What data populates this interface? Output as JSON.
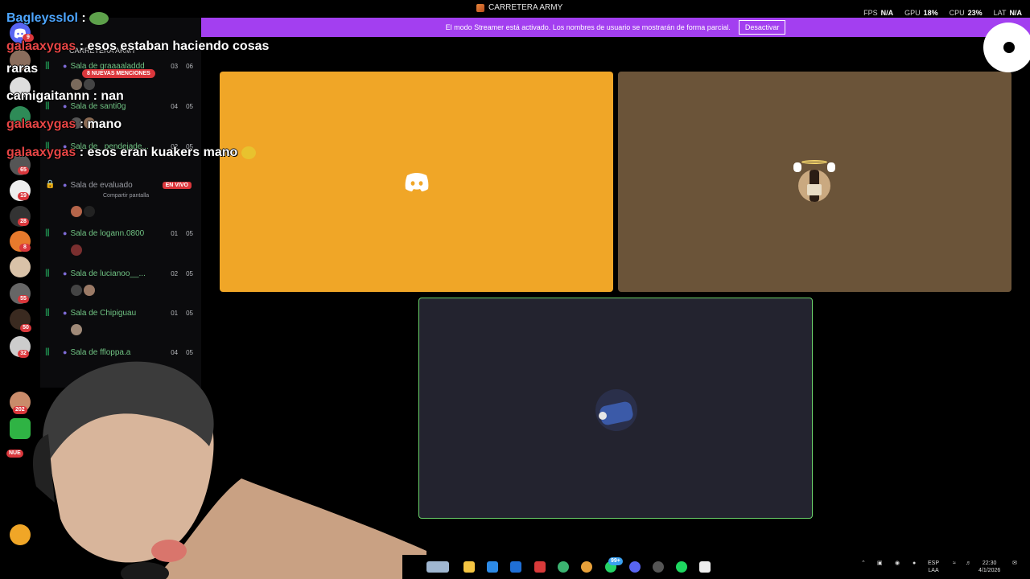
{
  "window": {
    "title": "CARRETERA ARMY",
    "metrics": [
      {
        "label": "FPS",
        "value": "N/A"
      },
      {
        "label": "GPU",
        "value": "18%"
      },
      {
        "label": "CPU",
        "value": "23%"
      },
      {
        "label": "LAT",
        "value": "N/A"
      }
    ]
  },
  "streamer_banner": {
    "text": "El modo Streamer está activado. Los nombres de usuario se mostrarán de forma parcial.",
    "button": "Desactivar"
  },
  "server_rail": {
    "badges": [
      "9",
      "65",
      "19",
      "28",
      "8",
      "55",
      "50",
      "32",
      "202",
      "NUE"
    ]
  },
  "channel_list": {
    "server_name": "CARRETERA ARMY",
    "mentions_pill": "8 NUEVAS MENCIONES",
    "channels": [
      {
        "name": "Sala de graaaaladdd",
        "count": "03",
        "max": "06"
      },
      {
        "name": "Sala de santi0g",
        "count": "04",
        "max": "05"
      },
      {
        "name": "Sala de _pendejade...",
        "count": "02",
        "max": "05"
      },
      {
        "name": "Sala de evaluado",
        "live": "EN VIVO",
        "sub": "Compartir pantalla"
      },
      {
        "name": "Sala de logann.0800",
        "count": "01",
        "max": "05"
      },
      {
        "name": "Sala de lucianoo__...",
        "count": "02",
        "max": "05"
      },
      {
        "name": "Sala de Chipiguau",
        "count": "01",
        "max": "05"
      },
      {
        "name": "Sala de ffloppa.a",
        "count": "04",
        "max": "05"
      }
    ]
  },
  "chat_overlay": [
    {
      "user": "Bagleysslol",
      "sep": ":",
      "message": ""
    },
    {
      "user": "galaaxygas",
      "sep": ":",
      "message": "esos estaban haciendo cosas"
    },
    {
      "user": "",
      "sep": "",
      "message": "raras"
    },
    {
      "user": "camigaitannn",
      "sep": ":",
      "message": "nan"
    },
    {
      "user": "galaaxygas",
      "sep": ":",
      "message": "mano"
    },
    {
      "user": "galaaxygas",
      "sep": ":",
      "message": "esos eran kuakers mano"
    }
  ],
  "taskbar": {
    "lang": "ESP",
    "layout": "LAA",
    "time": "22:30",
    "date": "4/1/2026",
    "badge": "99+"
  },
  "colors": {
    "streamer_banner": "#a33ff0",
    "tile_orange": "#f0a627",
    "tile_brown": "#6b5439",
    "tile_navy": "#23232f",
    "speaking_border": "#6bd36b",
    "voice_green": "#23a55a",
    "alert_red": "#da373c"
  }
}
